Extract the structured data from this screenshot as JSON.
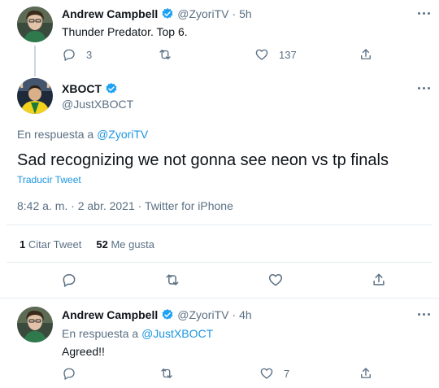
{
  "tweets": [
    {
      "author_name": "Andrew Campbell",
      "author_handle": "@ZyoriTV",
      "separator": "·",
      "time": "5h",
      "text": "Thunder Predator. Top 6.",
      "reply_count": "3",
      "retweet_count": "",
      "like_count": "137"
    },
    {
      "author_name": "XBOCT",
      "author_handle": "@JustXBOCT",
      "reply_prefix": "En respuesta a",
      "reply_to": "@ZyoriTV",
      "text": "Sad recognizing we not gonna see neon vs tp finals",
      "translate_label": "Traducir Tweet",
      "timestamp": "8:42 a. m. · 2 abr. 2021 · Twitter for iPhone",
      "quote_count": "1",
      "quote_label": "Citar Tweet",
      "like_count": "52",
      "like_label": "Me gusta"
    },
    {
      "author_name": "Andrew Campbell",
      "author_handle": "@ZyoriTV",
      "separator": "·",
      "time": "4h",
      "reply_prefix": "En respuesta a",
      "reply_to": "@JustXBOCT",
      "text": "Agreed!!",
      "reply_count": "",
      "retweet_count": "",
      "like_count": "7"
    }
  ],
  "icons": {
    "verified": "verified-badge-icon",
    "reply": "reply-icon",
    "retweet": "retweet-icon",
    "like": "heart-icon",
    "share": "share-icon",
    "more": "more-icon"
  },
  "colors": {
    "accent": "#1b95e0",
    "secondary_text": "#5b7083",
    "divider": "#e6ecf0",
    "verified": "#1da1f2"
  }
}
